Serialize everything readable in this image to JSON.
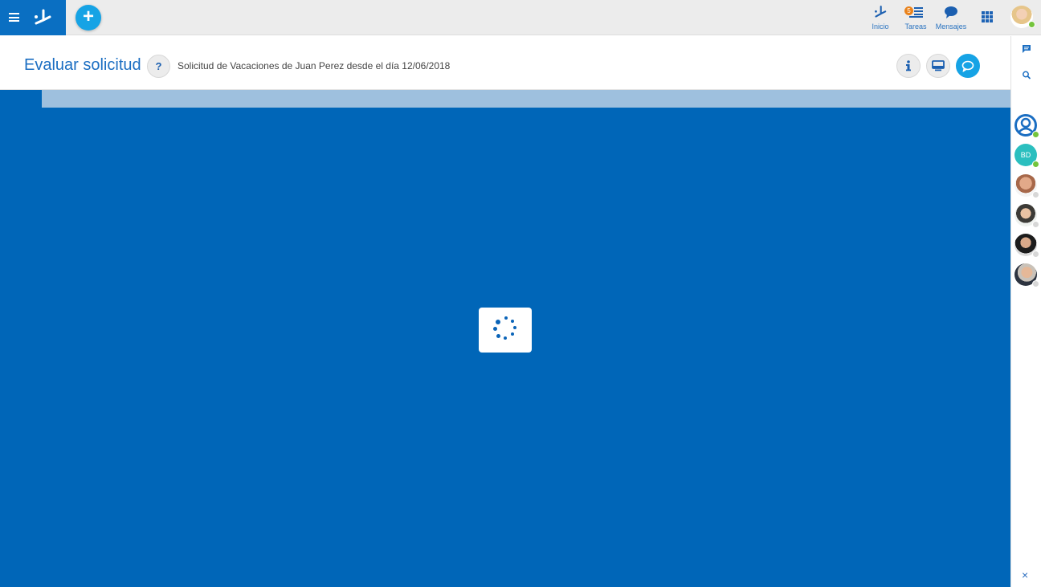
{
  "topbar": {
    "nav": {
      "home_label": "Inicio",
      "tasks_label": "Tareas",
      "tasks_count": "5",
      "messages_label": "Mensajes"
    }
  },
  "header": {
    "title": "Evaluar solicitud",
    "help_label": "?",
    "subtitle": "Solicitud de Vacaciones de Juan  Perez desde el día 12/06/2018"
  },
  "rail": {
    "contacts": [
      {
        "initials": "BD",
        "status": "online"
      }
    ],
    "close_label": "×"
  },
  "colors": {
    "brand": "#0a6fc2",
    "accent": "#16a3e5",
    "main_background": "#0066b8",
    "strip": "#9ec0de",
    "badge": "#e9821b",
    "online": "#74c43c"
  }
}
